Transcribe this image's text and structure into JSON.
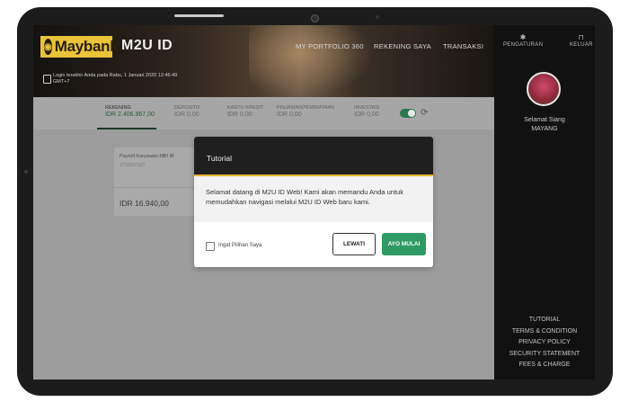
{
  "app": {
    "brand": "Maybank",
    "title": "M2U ID"
  },
  "nav": {
    "portfolio": "MY PORTFOLIO 360",
    "accounts": "REKENING SAYA",
    "transactions": "TRANSAKSI"
  },
  "login_info": "Login terakhir Anda pada Rabu, 1 Januari 2020 12:46:49 GMT+7",
  "right_panel": {
    "settings": "PENGATURAN",
    "logout": "KELUAR",
    "greeting": "Selamat Siang",
    "username": "MAYANG",
    "footer_links": [
      "TUTORIAL",
      "TERMS & CONDITION",
      "PRIVACY POLICY",
      "SECURITY STATEMENT",
      "FEES & CHARGE"
    ]
  },
  "tabs": [
    {
      "label": "REKENING",
      "amount": "IDR 2.406.967,00"
    },
    {
      "label": "DEPOSITO",
      "amount": "IDR 0,00"
    },
    {
      "label": "KARTU KREDIT",
      "amount": "IDR 0,00"
    },
    {
      "label": "PINJAMAN/PEMBIAYAAN",
      "amount": "IDR 0,00"
    },
    {
      "label": "INVESTASI",
      "amount": "IDR 0,00"
    }
  ],
  "card": {
    "title": "Payroll Karyawan MBI IB",
    "number": "2710007160",
    "amount": "IDR 16.940,00"
  },
  "modal": {
    "title": "Tutorial",
    "text": "Selamat datang di M2U ID Web! Kami akan memandu Anda untuk memudahkan navigasi melalui M2U ID Web baru kami.",
    "remember_label": "Ingat Pilihan Saya",
    "skip_label": "LEWATI",
    "go_label": "AYO MULAI"
  },
  "colors": {
    "accent_green": "#2f9a63",
    "brand_yellow": "#e9c33a",
    "modal_header": "#1f1f1f"
  }
}
